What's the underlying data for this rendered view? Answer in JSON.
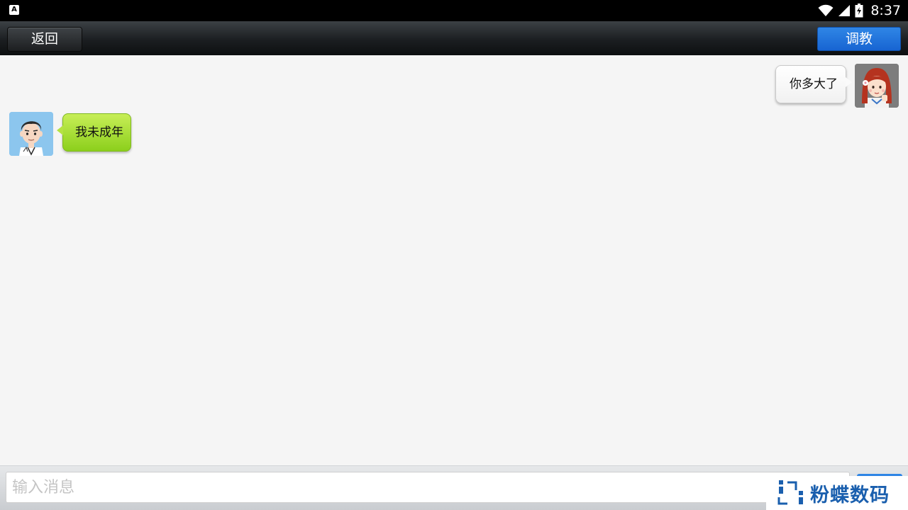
{
  "status_bar": {
    "notification_icon": "a-box-icon",
    "notification_letter": "A",
    "icons": [
      "wifi-icon",
      "signal-icon",
      "battery-icon"
    ],
    "time": "8:37"
  },
  "toolbar": {
    "back_label": "返回",
    "train_label": "调教"
  },
  "messages": [
    {
      "side": "right",
      "text": "你多大了",
      "avatar": "girl-avatar"
    },
    {
      "side": "left",
      "text": "我未成年",
      "avatar": "boy-avatar"
    }
  ],
  "input": {
    "placeholder": "输入消息",
    "value": ""
  },
  "watermark": {
    "text": "粉蝶数码"
  },
  "colors": {
    "status_bar": "#000000",
    "toolbar_dark": "#1b1e21",
    "accent_blue": "#1f72dc",
    "bubble_green": "#a6dd35",
    "bubble_white": "#ffffff",
    "background": "#f5f5f5",
    "watermark_blue": "#1a5fae"
  }
}
